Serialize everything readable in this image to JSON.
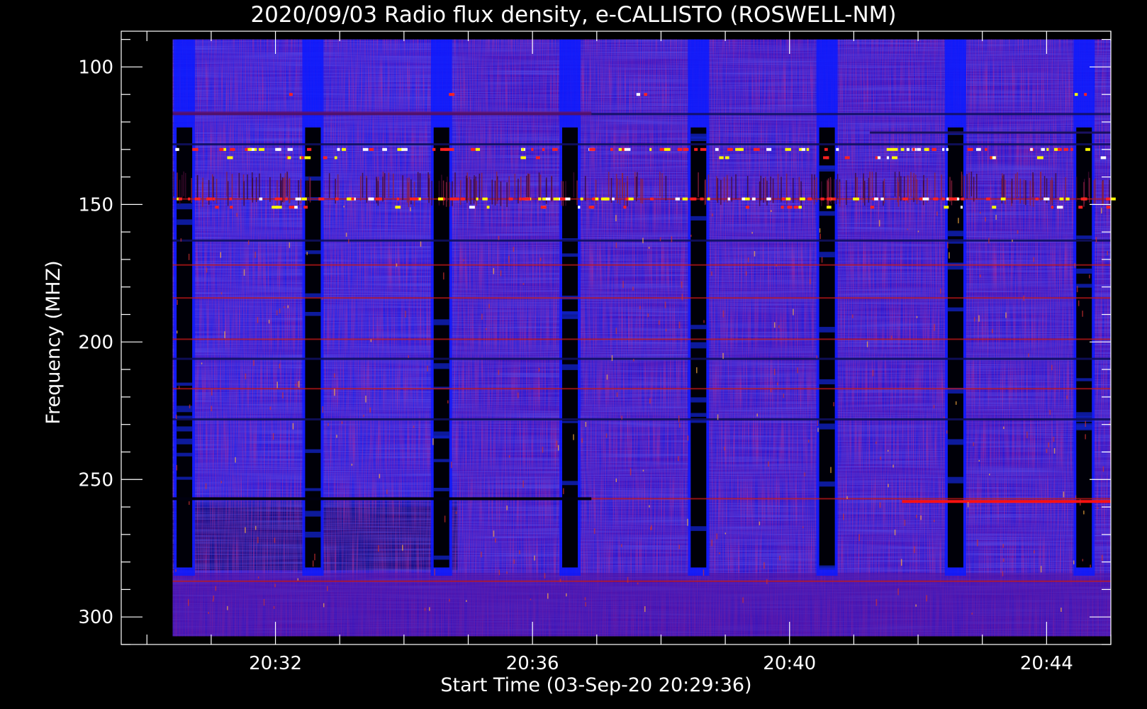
{
  "chart_data": {
    "type": "heatmap",
    "title": "2020/09/03  Radio flux density, e-CALLISTO (ROSWELL-NM)",
    "xlabel": "Start Time (03-Sep-20 20:29:36)",
    "ylabel": "Frequency (MHZ)",
    "x_unit": "HH:MM (UT)",
    "xlim": [
      "20:29:36",
      "20:45:00"
    ],
    "ylim": [
      310,
      87
    ],
    "x_major_ticks": [
      "20:32",
      "20:36",
      "20:40",
      "20:44"
    ],
    "y_major_ticks": [
      100,
      150,
      200,
      250,
      300
    ],
    "data_xrange": [
      "20:30:24",
      "20:45:00"
    ],
    "data_yrange": [
      90,
      307
    ],
    "colormap": [
      "#000000",
      "#0000ff",
      "#ff0000",
      "#ffff00",
      "#ffffff"
    ],
    "gap_columns": [
      "20:30:35",
      "20:32:35",
      "20:34:35",
      "20:36:35",
      "20:38:35",
      "20:40:35",
      "20:42:35",
      "20:44:35"
    ],
    "gap_freq_range": [
      122,
      282
    ],
    "interference_bands_mhz": [
      117,
      128,
      148,
      163,
      172,
      184,
      199,
      206,
      217,
      228,
      257,
      287
    ],
    "burst_band_mhz": 258,
    "grid": false,
    "legend": "none"
  },
  "colors": {
    "background": "#000000",
    "axes": "#ffffff",
    "base": "#2a18d0",
    "low": "#0000ff",
    "mid": "#c01010",
    "high": "#ffff00",
    "peak": "#ffffff"
  }
}
